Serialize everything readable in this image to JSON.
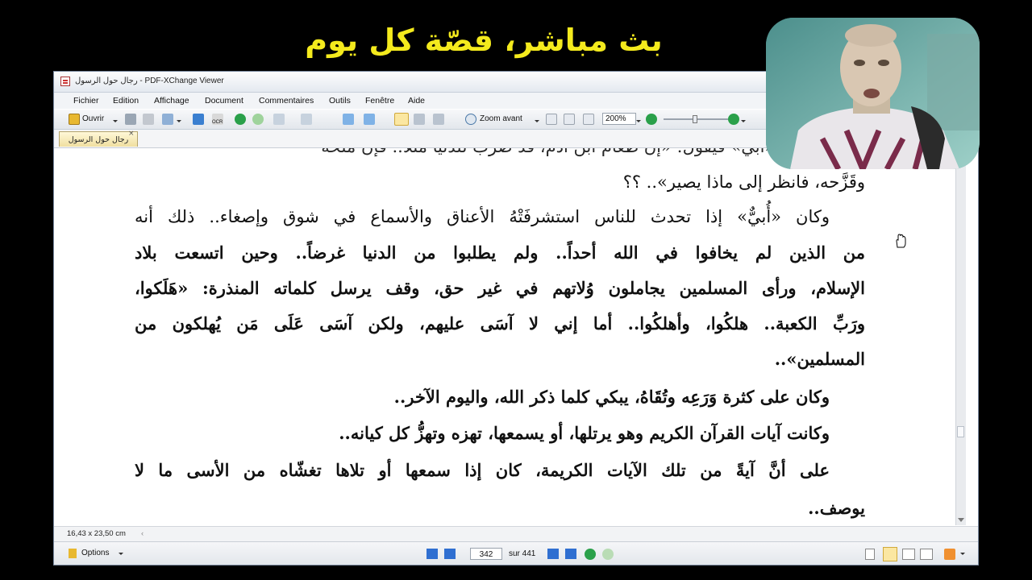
{
  "banner": {
    "text": "بث مباشر، قصّة كل يوم"
  },
  "window": {
    "title": "رجال حول الرسول - PDF-XChange Viewer",
    "menu": [
      "Fichier",
      "Edition",
      "Affichage",
      "Document",
      "Commentaires",
      "Outils",
      "Fenêtre",
      "Aide"
    ],
    "toolbar": {
      "open_label": "Ouvrir",
      "ocr_label": "OCR",
      "zoom_label": "Zoom avant",
      "zoom_value": "200%"
    },
    "tab": {
      "label": "رجال حول الرسول",
      "close": "×"
    }
  },
  "document": {
    "lines": [
      "الدنيا يتحدث «أبي» فيقول: «إن طعام ابن آدم، قد ضرب للدنيا مثلاً.. فإن ملّحه",
      "وقَزَّحه، فانظر إلى ماذا يصير».. ؟؟",
      "وكان «أُبيٌّ» إذا تحدث للناس استشرفَتْهُ الأعناق والأسماع في شوق وإصغاء.. ذلك أنه",
      "من الذين لم يخافوا في الله أحداً.. ولم يطلبوا من الدنيا غرضاً.. وحين اتسعت بلاد",
      "الإسلام، ورأى المسلمين يجاملون وُلاتهم في غير حق، وقف يرسل كلماته المنذرة: «هَلَكوا،",
      "ورَبِّ الكعبة.. هلكُوا، وأهلكُوا.. أما إني لا آسَى عليهم، ولكن آسَى عَلَى مَن يُهلكون من",
      "المسلمين»..",
      "وكان على كثرة وَرَعِه وتُقَاهُ، يبكي كلما ذكر الله، واليوم الآخر..",
      "وكانت آيات القرآن الكريم وهو يرتلها، أو يسمعها، تهزه وتهزُّ كل كيانه..",
      "على أنَّ آيةً من تلك الآيات الكريمة، كان إذا سمعها أو تلاها تغشّاه من الأسى ما لا",
      "يوصف.."
    ]
  },
  "status": {
    "page_size": "16,43 x 23,50 cm",
    "options_label": "Options",
    "current_page": "342",
    "total_pages": "sur 441"
  },
  "colors": {
    "banner": "#f4ea1d",
    "background": "#000000"
  }
}
